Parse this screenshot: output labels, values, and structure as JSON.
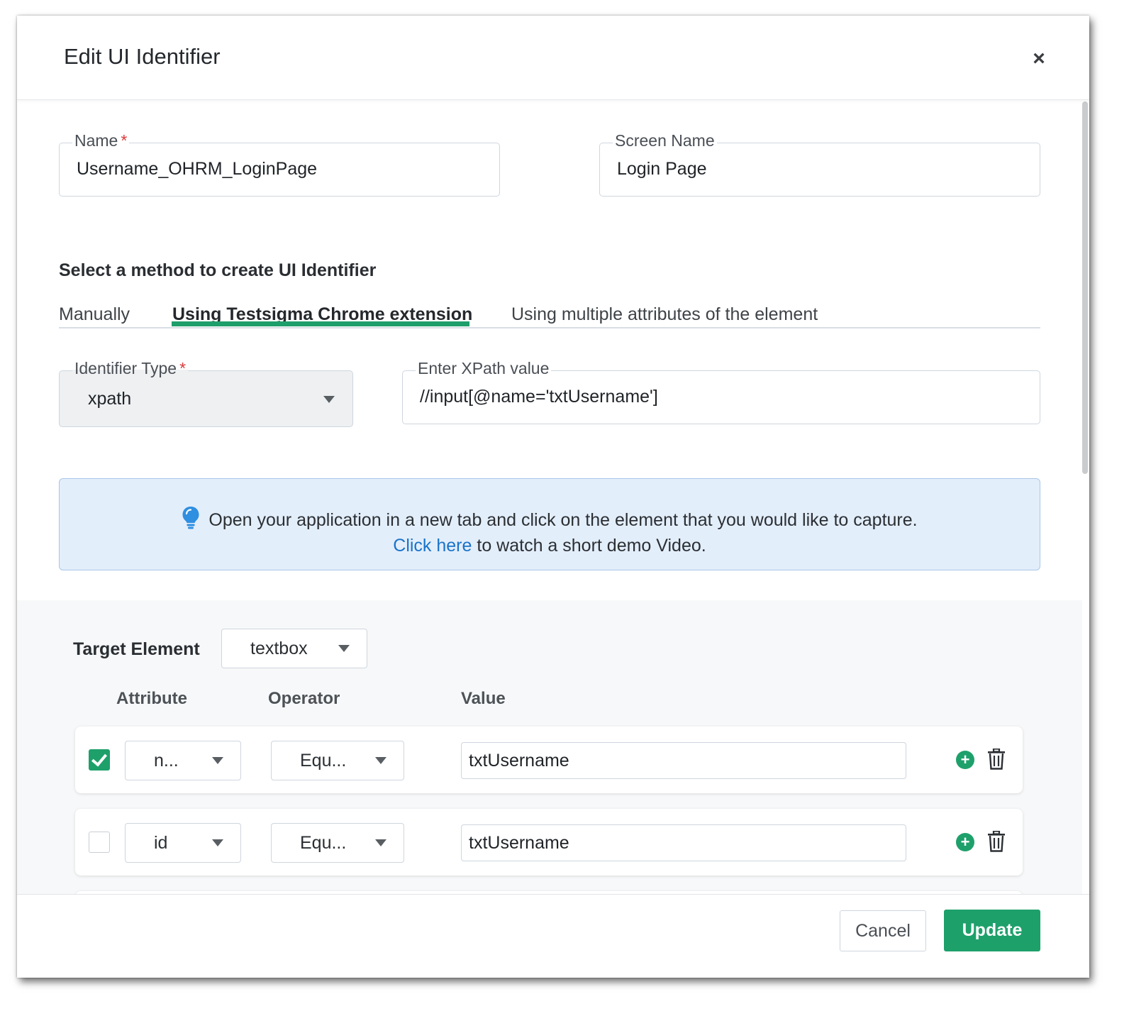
{
  "dialog": {
    "title": "Edit UI Identifier"
  },
  "fields": {
    "name": {
      "label": "Name",
      "required_mark": "*",
      "value": "Username_OHRM_LoginPage"
    },
    "screen_name": {
      "label": "Screen Name",
      "value": "Login Page"
    }
  },
  "method": {
    "title": "Select a method to create UI Identifier",
    "tabs": [
      {
        "label": "Manually",
        "active": false
      },
      {
        "label": "Using Testsigma Chrome extension",
        "active": true
      },
      {
        "label": "Using multiple attributes of the element",
        "active": false
      }
    ]
  },
  "identifier": {
    "type_label": "Identifier Type",
    "required_mark": "*",
    "type_value": "xpath",
    "xpath_label": "Enter XPath value",
    "xpath_value": "//input[@name='txtUsername']"
  },
  "info": {
    "message": "Open your application in a new tab and click on the element that you would like to capture.",
    "link_text": "Click here",
    "link_suffix": " to watch a short demo Video.",
    "icon": "lightbulb-icon",
    "accent_color": "#1a73c9"
  },
  "target": {
    "label": "Target Element",
    "value": "textbox",
    "columns": {
      "attribute": "Attribute",
      "operator": "Operator",
      "value": "Value"
    },
    "rows": [
      {
        "checked": true,
        "attribute": "n...",
        "operator": "Equ...",
        "value": "txtUsername"
      },
      {
        "checked": false,
        "attribute": "id",
        "operator": "Equ...",
        "value": "txtUsername"
      }
    ]
  },
  "footer": {
    "cancel_label": "Cancel",
    "update_label": "Update"
  },
  "colors": {
    "primary": "#1ea06b",
    "info_bg": "#e3eefb",
    "required": "#d93a3a"
  }
}
